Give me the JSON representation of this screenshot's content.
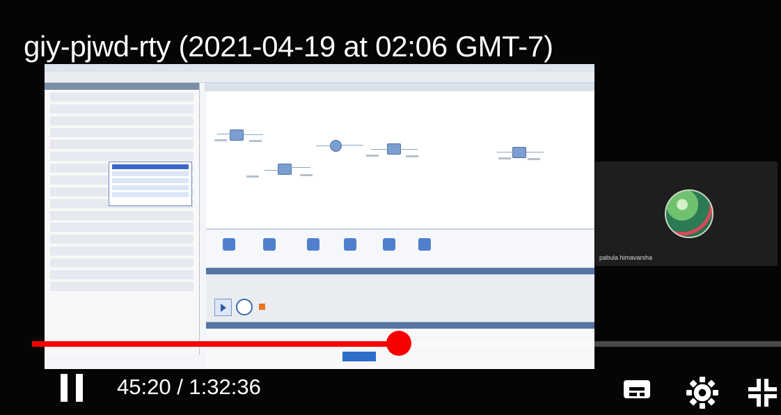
{
  "player": {
    "title": "giy-pjwd-rty (2021-04-19 at 02:06 GMT-7)",
    "time": "45:20 / 1:32:36",
    "progress": 0.49,
    "colors": {
      "accent": "#f60000",
      "background": "#000000",
      "text": "#ffffff"
    }
  },
  "participant": {
    "name": "pabula himavarsha"
  },
  "controls": {
    "pause_icon": "pause-icon",
    "subtitles_icon": "subtitles-icon",
    "settings_icon": "settings-icon",
    "exit_fullscreen_icon": "exit-fullscreen-icon"
  }
}
